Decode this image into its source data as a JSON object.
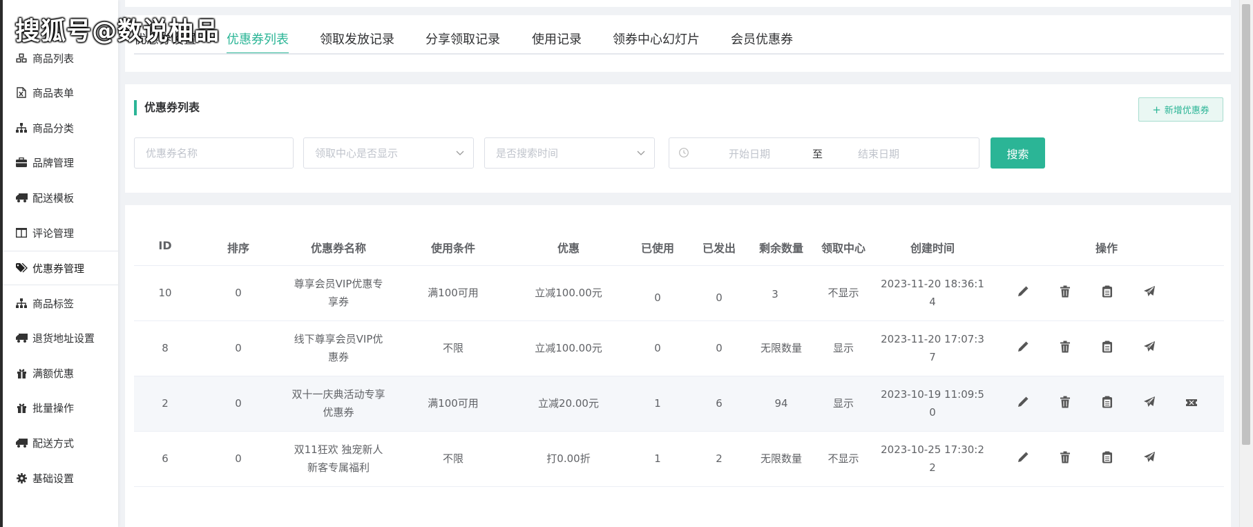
{
  "watermark": "搜狐号@数说柚品",
  "sidebar": {
    "items": [
      {
        "label": "商品列表",
        "icon": "cubes-icon"
      },
      {
        "label": "商品表单",
        "icon": "file-excel-icon"
      },
      {
        "label": "商品分类",
        "icon": "sitemap-icon"
      },
      {
        "label": "品牌管理",
        "icon": "briefcase-icon"
      },
      {
        "label": "配送模板",
        "icon": "truck-icon"
      },
      {
        "label": "评论管理",
        "icon": "columns-icon"
      },
      {
        "label": "优惠券管理",
        "icon": "tags-icon",
        "active": true
      },
      {
        "label": "商品标签",
        "icon": "sitemap-icon"
      },
      {
        "label": "退货地址设置",
        "icon": "truck-icon"
      },
      {
        "label": "满额优惠",
        "icon": "gift-icon"
      },
      {
        "label": "批量操作",
        "icon": "gift-icon"
      },
      {
        "label": "配送方式",
        "icon": "truck-icon"
      },
      {
        "label": "基础设置",
        "icon": "gear-icon"
      }
    ]
  },
  "tabs": [
    {
      "label": "优惠券设置"
    },
    {
      "label": "优惠券列表",
      "active": true
    },
    {
      "label": "领取发放记录"
    },
    {
      "label": "分享领取记录"
    },
    {
      "label": "使用记录"
    },
    {
      "label": "领券中心幻灯片"
    },
    {
      "label": "会员优惠券"
    }
  ],
  "search": {
    "section_title": "优惠券列表",
    "add_button": "新增优惠券",
    "name_placeholder": "优惠券名称",
    "center_placeholder": "领取中心是否显示",
    "time_placeholder": "是否搜索时间",
    "start_placeholder": "开始日期",
    "range_separator": "至",
    "end_placeholder": "结束日期",
    "search_button": "搜索"
  },
  "table": {
    "headers": {
      "id": "ID",
      "sort": "排序",
      "name": "优惠券名称",
      "condition": "使用条件",
      "discount": "优惠",
      "used": "已使用",
      "issued": "已发出",
      "remaining": "剩余数量",
      "center": "领取中心",
      "created": "创建时间",
      "actions": "操作"
    },
    "rows": [
      {
        "id": "10",
        "sort": "0",
        "name_1": "尊享会员VIP优惠专",
        "name_2": "享券",
        "condition": "满100可用",
        "discount": "立减100.00元",
        "used": "0",
        "issued": "0",
        "remaining": "3",
        "center": "不显示",
        "created_1": "2023-11-20 18:36:1",
        "created_2": "4"
      },
      {
        "id": "8",
        "sort": "0",
        "name_1": "线下尊享会员VIP优",
        "name_2": "惠券",
        "condition": "不限",
        "discount": "立减100.00元",
        "used": "0",
        "issued": "0",
        "remaining": "无限数量",
        "center": "显示",
        "created_1": "2023-11-20 17:07:3",
        "created_2": "7"
      },
      {
        "id": "2",
        "sort": "0",
        "name_1": "双十一庆典活动专享",
        "name_2": "优惠券",
        "condition": "满100可用",
        "discount": "立减20.00元",
        "used": "1",
        "issued": "6",
        "remaining": "94",
        "center": "显示",
        "created_1": "2023-10-19 11:09:5",
        "created_2": "0",
        "highlighted": true
      },
      {
        "id": "6",
        "sort": "0",
        "name_1": "双11狂欢 独宠新人",
        "name_2": "新客专属福利",
        "condition": "不限",
        "discount": "打0.00折",
        "used": "1",
        "issued": "2",
        "remaining": "无限数量",
        "center": "不显示",
        "created_1": "2023-10-25 17:30:2",
        "created_2": "2"
      }
    ]
  },
  "colors": {
    "accent": "#2bb596",
    "add_button_bg": "#eaf7f3",
    "highlight_row": "#f5f7fa",
    "page_bg": "#f0f2f5"
  }
}
